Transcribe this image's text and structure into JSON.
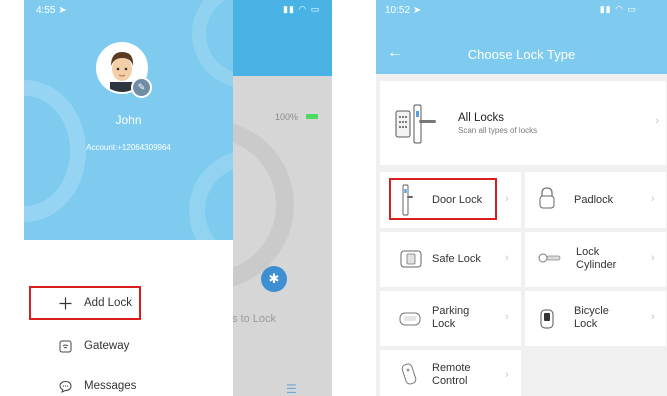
{
  "left_phone": {
    "status_time": "4:55",
    "user_name": "John",
    "account": "Account:+12064309964",
    "background_app": {
      "battery": "100%",
      "touch_text": "s to Lock"
    },
    "menu": [
      {
        "label": "Add Lock",
        "icon": "plus-icon"
      },
      {
        "label": "Gateway",
        "icon": "gateway-icon"
      },
      {
        "label": "Messages",
        "icon": "message-icon"
      }
    ]
  },
  "right_phone": {
    "status_time": "10:52",
    "title": "Choose Lock Type",
    "all_locks": {
      "title": "All Locks",
      "subtitle": "Scan all types of locks"
    },
    "lock_types": [
      {
        "label": "Door Lock",
        "icon": "door-lock-icon"
      },
      {
        "label": "Padlock",
        "icon": "padlock-icon"
      },
      {
        "label": "Safe Lock",
        "icon": "safe-lock-icon"
      },
      {
        "label": "Lock\nCylinder",
        "icon": "lock-cylinder-icon"
      },
      {
        "label": "Parking\nLock",
        "icon": "parking-lock-icon"
      },
      {
        "label": "Bicycle\nLock",
        "icon": "bicycle-lock-icon"
      },
      {
        "label": "Remote\nControl",
        "icon": "remote-control-icon"
      }
    ]
  },
  "colors": {
    "header_blue": "#7ecbef",
    "highlight_red": "#d81e1e",
    "dark_header_blue": "#4ab3e6"
  }
}
